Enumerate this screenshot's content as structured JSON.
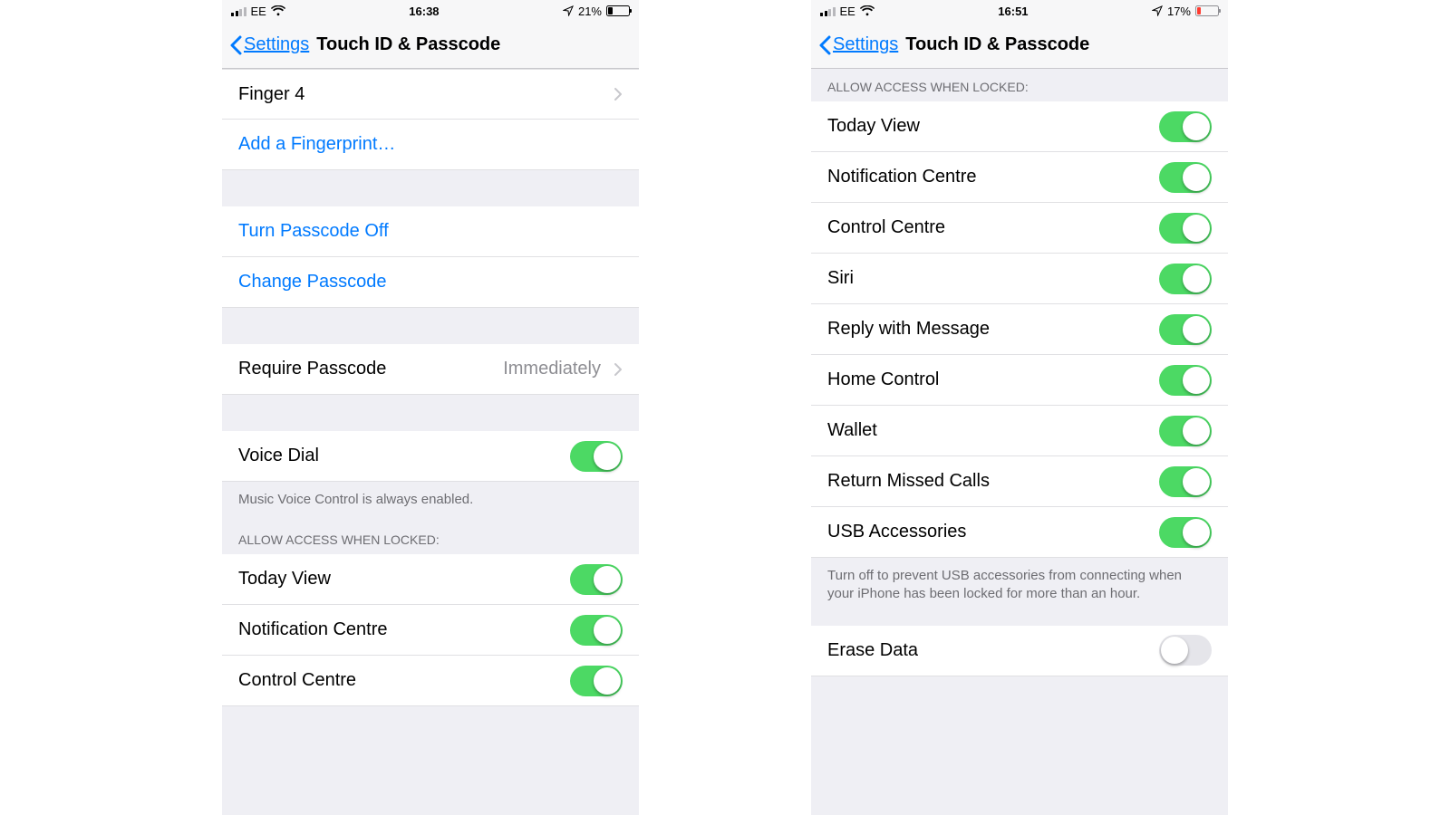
{
  "left": {
    "status": {
      "carrier": "EE",
      "time": "16:38",
      "battery_text": "21%",
      "battery_fill_pct": 21,
      "battery_low": false,
      "signal_bars": 2
    },
    "nav": {
      "back": "Settings",
      "title": "Touch ID & Passcode"
    },
    "finger_row": {
      "label": "Finger 4"
    },
    "add_fingerprint": "Add a Fingerprint…",
    "turn_off": "Turn Passcode Off",
    "change": "Change Passcode",
    "require": {
      "label": "Require Passcode",
      "value": "Immediately"
    },
    "voice_dial": {
      "label": "Voice Dial"
    },
    "voice_footer": "Music Voice Control is always enabled.",
    "allow_header": "ALLOW ACCESS WHEN LOCKED:",
    "allow": [
      {
        "label": "Today View"
      },
      {
        "label": "Notification Centre"
      },
      {
        "label": "Control Centre"
      }
    ]
  },
  "right": {
    "status": {
      "carrier": "EE",
      "time": "16:51",
      "battery_text": "17%",
      "battery_fill_pct": 17,
      "battery_low": true,
      "signal_bars": 2
    },
    "nav": {
      "back": "Settings",
      "title": "Touch ID & Passcode"
    },
    "allow_header": "ALLOW ACCESS WHEN LOCKED:",
    "allow": [
      {
        "label": "Today View"
      },
      {
        "label": "Notification Centre"
      },
      {
        "label": "Control Centre"
      },
      {
        "label": "Siri"
      },
      {
        "label": "Reply with Message"
      },
      {
        "label": "Home Control"
      },
      {
        "label": "Wallet"
      },
      {
        "label": "Return Missed Calls"
      },
      {
        "label": "USB Accessories"
      }
    ],
    "usb_footer": "Turn off to prevent USB accessories from connecting when your iPhone has been locked for more than an hour.",
    "erase": {
      "label": "Erase Data"
    }
  }
}
